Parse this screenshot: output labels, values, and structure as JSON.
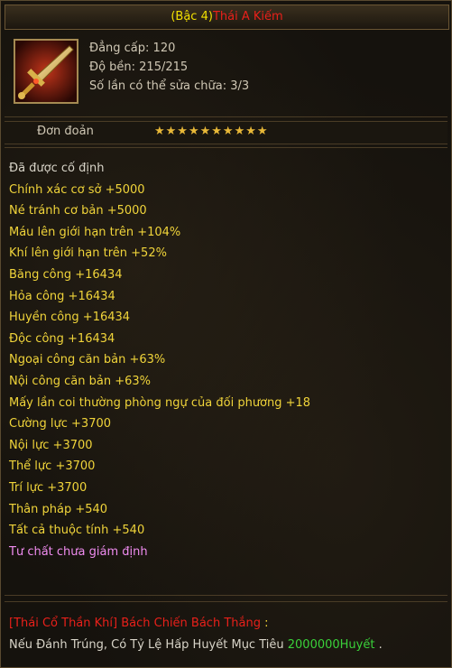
{
  "title": {
    "tier": "(Bậc 4)",
    "name": "Thái A Kiếm"
  },
  "item": {
    "icon": "sword-icon",
    "level": "Đẳng cấp: 120",
    "durability": "Độ bền: 215/215",
    "repairs": "Số lần có thể sửa chữa: 3/3"
  },
  "forge": {
    "label": "Đơn đoản",
    "stars": "★★★★★★★★★★",
    "star_count": 10
  },
  "attributes": [
    {
      "text": "Đã được cố định",
      "color": "white"
    },
    {
      "text": "Chính xác cơ sở +5000",
      "color": "yellow"
    },
    {
      "text": "Né tránh cơ bản +5000",
      "color": "yellow"
    },
    {
      "text": "Máu lên giới hạn trên +104%",
      "color": "yellow"
    },
    {
      "text": "Khí lên giới hạn trên +52%",
      "color": "yellow"
    },
    {
      "text": "Băng công +16434",
      "color": "yellow"
    },
    {
      "text": "Hỏa công +16434",
      "color": "yellow"
    },
    {
      "text": "Huyền công +16434",
      "color": "yellow"
    },
    {
      "text": "Độc công +16434",
      "color": "yellow"
    },
    {
      "text": "Ngoại công căn bản +63%",
      "color": "yellow"
    },
    {
      "text": "Nội công căn bản +63%",
      "color": "yellow"
    },
    {
      "text": "Mấy lần coi thường phòng ngự của đối phương +18",
      "color": "yellow"
    },
    {
      "text": "Cường lực +3700",
      "color": "yellow"
    },
    {
      "text": "Nội lực +3700",
      "color": "yellow"
    },
    {
      "text": "Thể lực +3700",
      "color": "yellow"
    },
    {
      "text": "Trí lực +3700",
      "color": "yellow"
    },
    {
      "text": "Thân pháp +540",
      "color": "yellow"
    },
    {
      "text": "Tất cả thuộc tính +540",
      "color": "yellow"
    },
    {
      "text": "Tư chất chưa giám định",
      "color": "pink"
    }
  ],
  "set_bonus": {
    "name": "[Thái Cổ Thần Khí] Bách Chiến Bách Thắng",
    "colon": " :",
    "desc": "Nếu Đánh Trúng, Có Tỷ Lệ Hấp Huyết Mục Tiêu ",
    "value": "2000000Huyết",
    "end": " ."
  },
  "colors": {
    "tier": "#f2e000",
    "name": "#e8201a",
    "attr": "#f0d43a",
    "pink": "#f08cf0",
    "green": "#3ad13a"
  }
}
